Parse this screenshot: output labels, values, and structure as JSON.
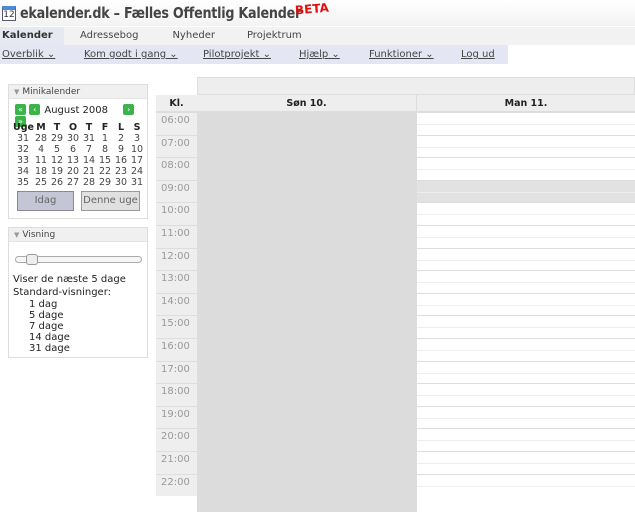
{
  "header": {
    "icon_text": "12",
    "title": "ekalender.dk  –  Fælles Offentlig Kalender",
    "beta": "BETA"
  },
  "tabs": [
    "Kalender",
    "Adressebog",
    "Nyheder",
    "Projektrum"
  ],
  "subnav": [
    "Overblik ⌄",
    "Kom godt i gang ⌄",
    "Pilotprojekt ⌄",
    "Hjælp ⌄",
    "Funktioner ⌄",
    "Log ud"
  ],
  "minikalender": {
    "title": "Minikalender",
    "month": "August 2008",
    "headers": [
      "Uge",
      "M",
      "T",
      "O",
      "T",
      "F",
      "L",
      "S"
    ],
    "rows": [
      [
        "31",
        "28",
        "29",
        "30",
        "31",
        "1",
        "2",
        "3"
      ],
      [
        "32",
        "4",
        "5",
        "6",
        "7",
        "8",
        "9",
        "10"
      ],
      [
        "33",
        "11",
        "12",
        "13",
        "14",
        "15",
        "16",
        "17"
      ],
      [
        "34",
        "18",
        "19",
        "20",
        "21",
        "22",
        "23",
        "24"
      ],
      [
        "35",
        "25",
        "26",
        "27",
        "28",
        "29",
        "30",
        "31"
      ]
    ],
    "today_btn": "Idag",
    "week_btn": "Denne uge"
  },
  "visning": {
    "title": "Visning",
    "slider_value": 1,
    "info": "Viser de næste 5 dage",
    "std_label": "Standard-visninger:",
    "options": [
      "1 dag",
      "5 dage",
      "7 dage",
      "14 dage",
      "31 dage"
    ]
  },
  "calendar": {
    "time_header": "Kl.",
    "days": [
      "Søn 10.",
      "Man 11."
    ],
    "hours": [
      "06:00",
      "07:00",
      "08:00",
      "09:00",
      "10:00",
      "11:00",
      "12:00",
      "13:00",
      "14:00",
      "15:00",
      "16:00",
      "17:00",
      "18:00",
      "19:00",
      "20:00",
      "21:00",
      "22:00"
    ]
  }
}
